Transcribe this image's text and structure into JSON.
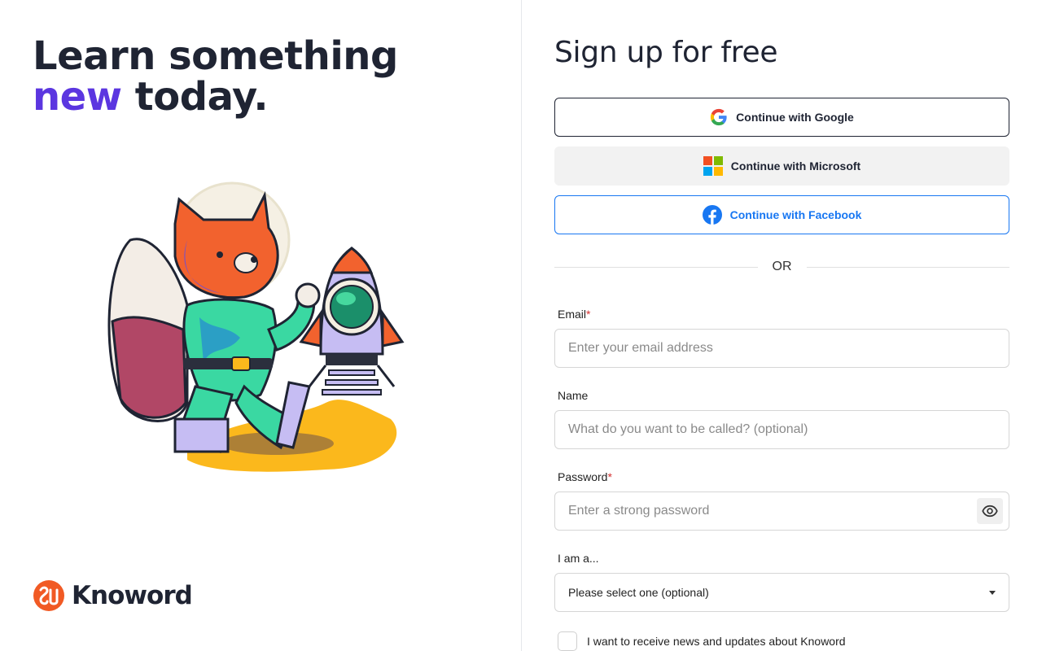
{
  "hero": {
    "line1": "Learn something",
    "accent": "new",
    "line2_rest": " today."
  },
  "brand": {
    "name": "Knoword",
    "color": "#f15a24"
  },
  "illustration": {
    "name": "fox-astronaut-with-rocket"
  },
  "signup": {
    "title": "Sign up for free",
    "google_label": "Continue with Google",
    "microsoft_label": "Continue with Microsoft",
    "facebook_label": "Continue with Facebook",
    "or_text": "OR"
  },
  "form": {
    "email": {
      "label": "Email",
      "required_mark": "*",
      "placeholder": "Enter your email address"
    },
    "name": {
      "label": "Name",
      "placeholder": "What do you want to be called? (optional)"
    },
    "password": {
      "label": "Password",
      "required_mark": "*",
      "placeholder": "Enter a strong password"
    },
    "role": {
      "label": "I am a...",
      "selected": "Please select one (optional)"
    },
    "newsletter": {
      "label": "I want to receive news and updates about Knoword"
    }
  },
  "colors": {
    "accent": "#5b36e0",
    "facebook": "#1877f2",
    "brand": "#f15a24",
    "text": "#1f2433"
  },
  "icons": {
    "google": "google-icon",
    "microsoft": "microsoft-icon",
    "facebook": "facebook-icon",
    "eye": "eye-icon",
    "caret": "caret-down-icon"
  }
}
